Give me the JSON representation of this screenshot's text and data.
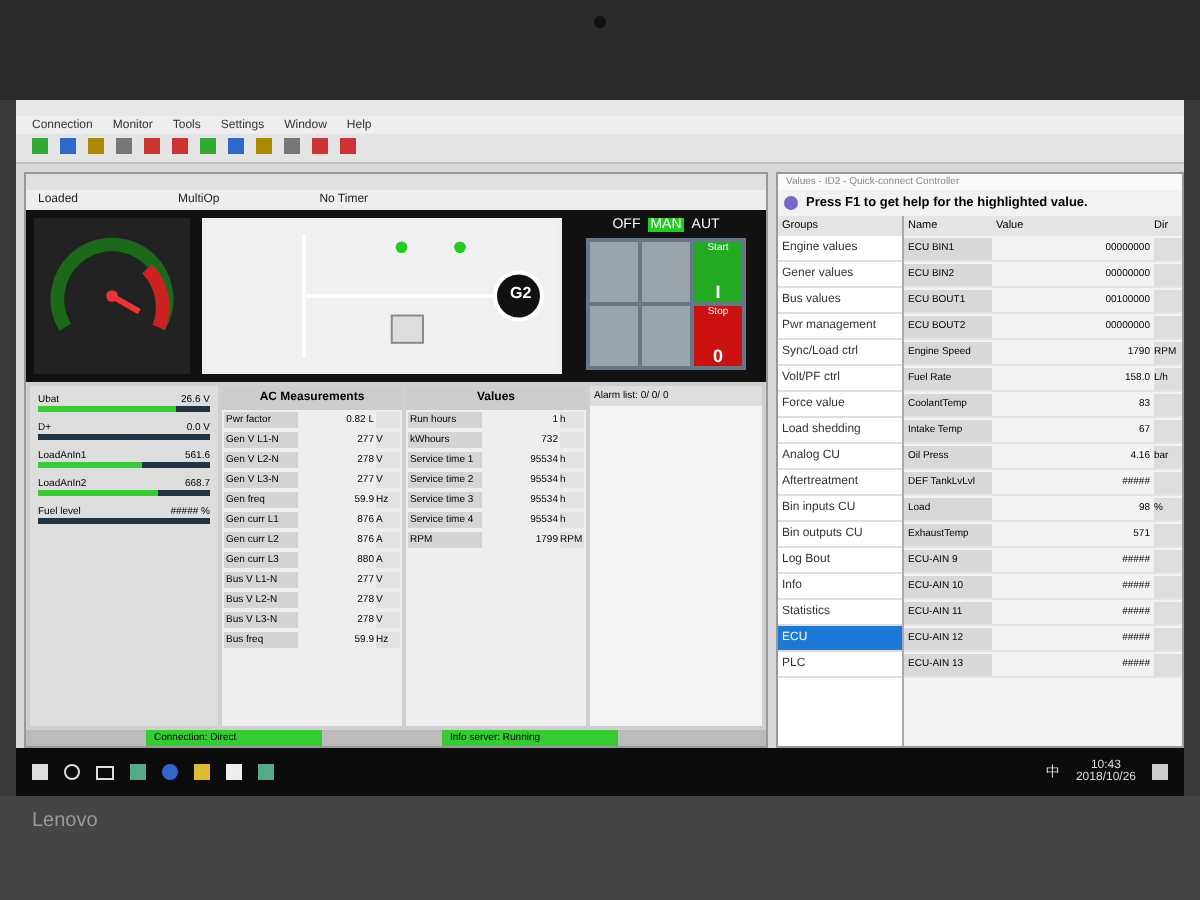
{
  "menu": [
    "Connection",
    "Monitor",
    "Tools",
    "Settings",
    "Window",
    "Help"
  ],
  "controller": {
    "status": [
      "Loaded",
      "MultiOp",
      "No Timer"
    ],
    "modes": [
      {
        "label": "OFF",
        "selected": false
      },
      {
        "label": "MAN",
        "selected": true
      },
      {
        "label": "AUT",
        "selected": false
      }
    ],
    "generator": "G2",
    "start": {
      "label": "Start",
      "symbol": "I"
    },
    "stop": {
      "label": "Stop",
      "symbol": "0"
    },
    "bars": [
      {
        "label": "Ubat",
        "reading": "26.6 V",
        "level": 0.8
      },
      {
        "label": "D+",
        "reading": "0.0 V",
        "level": 0.0
      },
      {
        "label": "LoadAnIn1",
        "reading": "561.6",
        "level": 0.6
      },
      {
        "label": "LoadAnIn2",
        "reading": "668.7",
        "level": 0.7
      },
      {
        "label": "Fuel level",
        "reading": "##### %",
        "level": 0.0
      }
    ],
    "ac_title": "AC Measurements",
    "ac_rows": [
      {
        "name": "Pwr factor",
        "value": "0.82 L",
        "unit": ""
      },
      {
        "name": "Gen V L1-N",
        "value": "277",
        "unit": "V"
      },
      {
        "name": "Gen V L2-N",
        "value": "278",
        "unit": "V"
      },
      {
        "name": "Gen V L3-N",
        "value": "277",
        "unit": "V"
      },
      {
        "name": "Gen freq",
        "value": "59.9",
        "unit": "Hz"
      },
      {
        "name": "Gen curr L1",
        "value": "876",
        "unit": "A"
      },
      {
        "name": "Gen curr L2",
        "value": "876",
        "unit": "A"
      },
      {
        "name": "Gen curr L3",
        "value": "880",
        "unit": "A"
      },
      {
        "name": "Bus V L1-N",
        "value": "277",
        "unit": "V"
      },
      {
        "name": "Bus V L2-N",
        "value": "278",
        "unit": "V"
      },
      {
        "name": "Bus V L3-N",
        "value": "278",
        "unit": "V"
      },
      {
        "name": "Bus freq",
        "value": "59.9",
        "unit": "Hz"
      }
    ],
    "values_title": "Values",
    "value_rows": [
      {
        "name": "Run hours",
        "value": "1",
        "unit": "h"
      },
      {
        "name": "kWhours",
        "value": "732",
        "unit": ""
      },
      {
        "name": "Service time 1",
        "value": "95534",
        "unit": "h"
      },
      {
        "name": "Service time 2",
        "value": "95534",
        "unit": "h"
      },
      {
        "name": "Service time 3",
        "value": "95534",
        "unit": "h"
      },
      {
        "name": "Service time 4",
        "value": "95534",
        "unit": "h"
      },
      {
        "name": "RPM",
        "value": "1799",
        "unit": "RPM"
      }
    ],
    "alarm_list": "Alarm list: 0/ 0/ 0"
  },
  "status_bar": [
    {
      "text": "Connection: Direct"
    },
    {
      "text": "Info server: Running"
    }
  ],
  "values_window": {
    "title": "Values - ID2 - Quick-connect Controller",
    "help": "Press F1 to get help for the highlighted value.",
    "groups_header": "Groups",
    "groups": [
      {
        "label": "Engine values",
        "selected": false
      },
      {
        "label": "Gener values",
        "selected": false
      },
      {
        "label": "Bus values",
        "selected": false
      },
      {
        "label": "Pwr management",
        "selected": false
      },
      {
        "label": "Sync/Load ctrl",
        "selected": false
      },
      {
        "label": "Volt/PF ctrl",
        "selected": false
      },
      {
        "label": "Force value",
        "selected": false
      },
      {
        "label": "Load shedding",
        "selected": false
      },
      {
        "label": "Analog CU",
        "selected": false
      },
      {
        "label": "Aftertreatment",
        "selected": false
      },
      {
        "label": "Bin inputs CU",
        "selected": false
      },
      {
        "label": "Bin outputs CU",
        "selected": false
      },
      {
        "label": "Log Bout",
        "selected": false
      },
      {
        "label": "Info",
        "selected": false
      },
      {
        "label": "Statistics",
        "selected": false
      },
      {
        "label": "ECU",
        "selected": true
      },
      {
        "label": "PLC",
        "selected": false
      }
    ],
    "columns": [
      "Name",
      "Value",
      "Dir"
    ],
    "rows": [
      {
        "name": "ECU BIN1",
        "value": "00000000",
        "dim": ""
      },
      {
        "name": "ECU BIN2",
        "value": "00000000",
        "dim": ""
      },
      {
        "name": "ECU BOUT1",
        "value": "00100000",
        "dim": ""
      },
      {
        "name": "ECU BOUT2",
        "value": "00000000",
        "dim": ""
      },
      {
        "name": "Engine Speed",
        "value": "1790",
        "dim": "RPM"
      },
      {
        "name": "Fuel Rate",
        "value": "158.0",
        "dim": "L/h"
      },
      {
        "name": "CoolantTemp",
        "value": "83",
        "dim": ""
      },
      {
        "name": "Intake Temp",
        "value": "67",
        "dim": ""
      },
      {
        "name": "Oil Press",
        "value": "4.16",
        "dim": "bar"
      },
      {
        "name": "DEF TankLvLvl",
        "value": "#####",
        "dim": ""
      },
      {
        "name": "Load",
        "value": "98",
        "dim": "%"
      },
      {
        "name": "ExhaustTemp",
        "value": "571",
        "dim": ""
      },
      {
        "name": "ECU-AIN 9",
        "value": "#####",
        "dim": ""
      },
      {
        "name": "ECU-AIN 10",
        "value": "#####",
        "dim": ""
      },
      {
        "name": "ECU-AIN 11",
        "value": "#####",
        "dim": ""
      },
      {
        "name": "ECU-AIN 12",
        "value": "#####",
        "dim": ""
      },
      {
        "name": "ECU-AIN 13",
        "value": "#####",
        "dim": ""
      }
    ]
  },
  "taskbar": {
    "time": "10:43",
    "date": "2018/10/26",
    "ime": "中"
  },
  "bezel": {
    "brand": "Lenovo"
  }
}
